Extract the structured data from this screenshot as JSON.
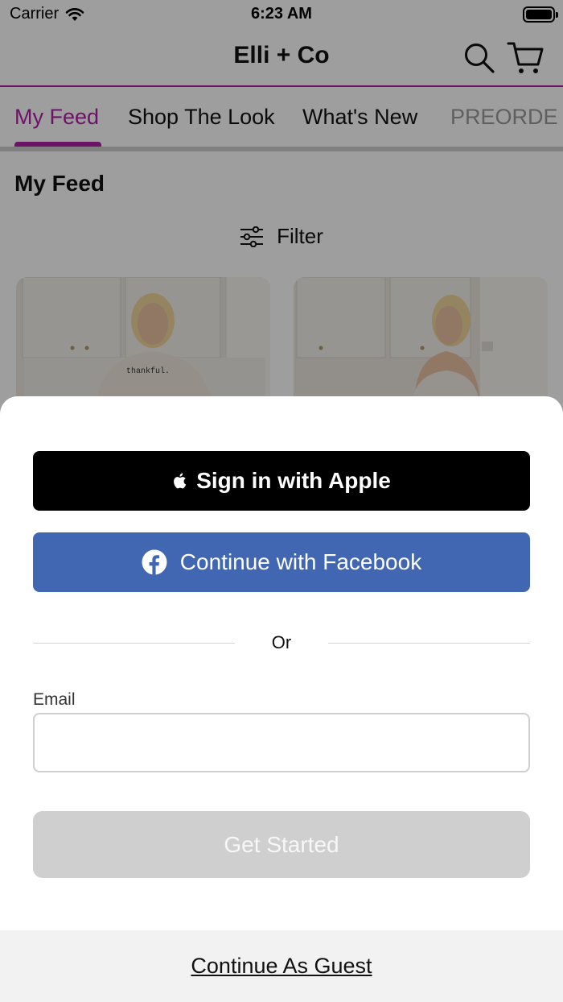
{
  "status_bar": {
    "carrier": "Carrier",
    "time": "6:23 AM"
  },
  "header": {
    "title": "Elli + Co",
    "icons": [
      "search-icon",
      "cart-icon"
    ]
  },
  "tabs": [
    {
      "label": "My Feed",
      "active": true
    },
    {
      "label": "Shop The Look",
      "active": false
    },
    {
      "label": "What's New",
      "active": false
    },
    {
      "label": "PREORDE",
      "active": false
    }
  ],
  "feed": {
    "heading": "My Feed",
    "filter_label": "Filter",
    "cards": [
      {
        "shirt_text": "thankful."
      },
      {
        "shirt_text": ""
      }
    ]
  },
  "sheet": {
    "apple_label": "Sign in with Apple",
    "facebook_label": "Continue with Facebook",
    "divider": "Or",
    "email_label": "Email",
    "email_value": "",
    "email_placeholder": "",
    "get_started_label": "Get Started",
    "guest_label": "Continue As Guest"
  },
  "colors": {
    "brand_accent": "#b01fa6",
    "facebook_blue": "#4267b2",
    "disabled_button": "#cfcfcf"
  }
}
